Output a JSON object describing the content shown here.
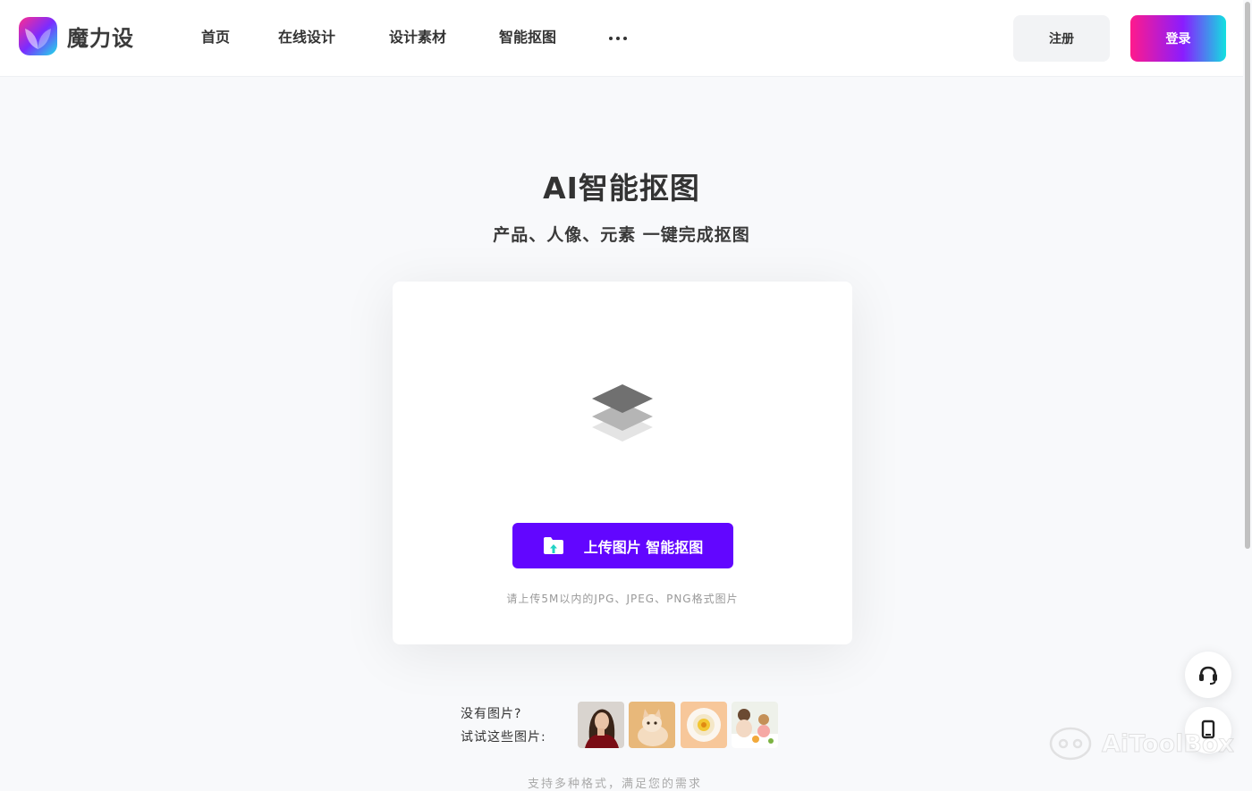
{
  "header": {
    "logo_text": "魔力设",
    "nav": [
      {
        "label": "首页"
      },
      {
        "label": "在线设计"
      },
      {
        "label": "设计素材"
      },
      {
        "label": "智能抠图"
      }
    ],
    "register_label": "注册",
    "login_label": "登录"
  },
  "hero": {
    "title": "AI智能抠图",
    "subtitle": "产品、人像、元素 一键完成抠图"
  },
  "upload": {
    "button_label": "上传图片 智能抠图",
    "hint": "请上传5M以内的JPG、JPEG、PNG格式图片"
  },
  "samples": {
    "line1": "没有图片?",
    "line2": "试试这些图片:",
    "items": [
      {
        "name": "woman-portrait"
      },
      {
        "name": "cat"
      },
      {
        "name": "food-plate"
      },
      {
        "name": "family-dining"
      }
    ]
  },
  "bottom_text": "支持多种格式，满足您的需求",
  "watermark": "AiToolBox",
  "colors": {
    "accent": "#6206ff",
    "login_gradient": [
      "#ff1a8c",
      "#8a1cff",
      "#12e0e0"
    ],
    "background": "#f8f9fb"
  }
}
